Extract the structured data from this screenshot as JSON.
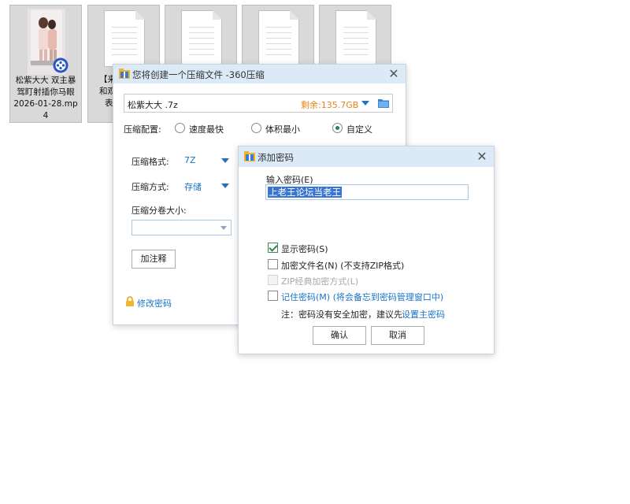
{
  "files": [
    {
      "caption_lines": [
        "松紫大大 双主暴",
        "驾盯射插你马眼",
        "2026-01-28.mp",
        "4"
      ]
    },
    {
      "caption_visible": [
        "【来",
        "和观",
        "表"
      ]
    },
    {
      "caption_visible": []
    },
    {
      "caption_visible": []
    },
    {
      "caption_visible": []
    }
  ],
  "compress_dialog": {
    "title": "您将创建一个压缩文件 -360压缩",
    "filename": "松紫大大 .7z",
    "free_space_label": "剩余:135.7GB",
    "config_label": "压缩配置:",
    "options": [
      "速度最快",
      "体积最小",
      "自定义"
    ],
    "selected_option": "自定义",
    "format_label": "压缩格式:",
    "format_value": "7Z",
    "method_label": "压缩方式:",
    "method_value": "存储",
    "volume_label": "压缩分卷大小:",
    "volume_value": "",
    "comment_button": "加注释",
    "change_password_link": "修改密码"
  },
  "password_dialog": {
    "title": "添加密码",
    "input_label": "输入密码(E)",
    "password_value": "上老王论坛当老王",
    "show_password": "显示密码(S)",
    "encrypt_names": "加密文件名(N) (不支持ZIP格式)",
    "zip_classic": "ZIP经典加密方式(L)",
    "remember_password": "记住密码(M) (将会备忘到密码管理窗口中)",
    "note_prefix": "注：密码没有安全加密，建议先",
    "note_link": "设置主密码",
    "confirm_button": "确认",
    "cancel_button": "取消",
    "show_password_checked": true,
    "encrypt_names_checked": false,
    "remember_password_checked": false
  }
}
